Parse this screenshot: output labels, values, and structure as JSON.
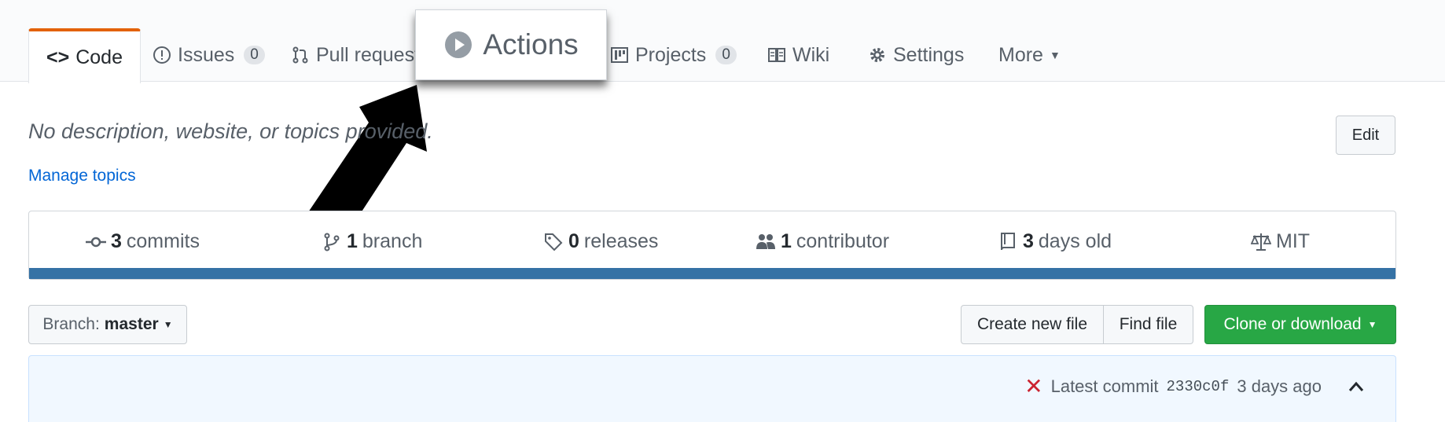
{
  "tabs": [
    {
      "label": "Code",
      "icon": "code-icon",
      "selected": true
    },
    {
      "label": "Issues",
      "icon": "issue-icon",
      "count": "0"
    },
    {
      "label": "Pull request",
      "icon": "pull-request-icon"
    },
    {
      "label": "Projects",
      "icon": "project-icon",
      "count": "0"
    },
    {
      "label": "Wiki",
      "icon": "book-icon"
    },
    {
      "label": "Settings",
      "icon": "gear-icon"
    },
    {
      "label": "More",
      "icon": "caret-down-icon"
    }
  ],
  "popup": {
    "label": "Actions",
    "icon": "play-icon"
  },
  "repo": {
    "description": "No description, website, or topics provided.",
    "manage_topics": "Manage topics",
    "edit_label": "Edit"
  },
  "stats": [
    {
      "value": "3",
      "label": "commits",
      "icon": "commit-icon"
    },
    {
      "value": "1",
      "label": "branch",
      "icon": "branch-icon"
    },
    {
      "value": "0",
      "label": "releases",
      "icon": "tag-icon"
    },
    {
      "value": "1",
      "label": "contributor",
      "icon": "people-icon"
    },
    {
      "value": "3",
      "label": "days old",
      "icon": "repo-icon"
    },
    {
      "value": "",
      "label": "MIT",
      "icon": "law-icon"
    }
  ],
  "language_bar_color": "#3572a5",
  "toolbar": {
    "branch_prefix": "Branch:",
    "branch_name": "master",
    "create_file": "Create new file",
    "find_file": "Find file",
    "clone": "Clone or download"
  },
  "commit": {
    "status_icon": "x-icon",
    "label": "Latest commit",
    "sha": "2330c0f",
    "age": "3 days ago"
  },
  "colors": {
    "accent": "#e36209",
    "link": "#0366d6",
    "clone_green": "#28a745",
    "fail_red": "#cb2431"
  }
}
